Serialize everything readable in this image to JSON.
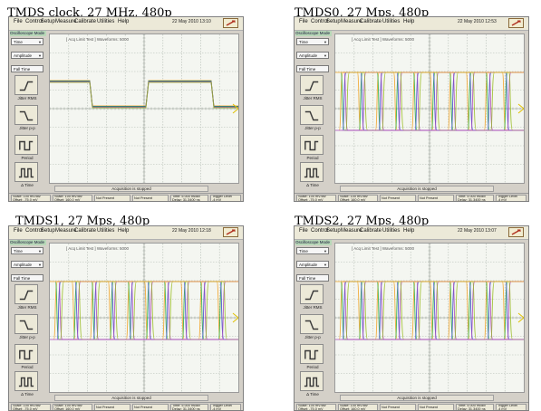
{
  "panels": [
    {
      "caption": "TMDS clock, 27 MHz, 480p",
      "date": "22 May 2010  13:10",
      "acq_title": "[ Acq Limit Test ]   Waveforms: 5000",
      "signal": "clock"
    },
    {
      "caption": "TMDS0, 27 Mps, 480p",
      "date": "22 May 2010  12:53",
      "acq_title": "[ Acq Limit Test ]   Waveforms: 5000",
      "signal": "eye"
    },
    {
      "caption": "TMDS1, 27 Mps, 480p",
      "date": "22 May 2010  12:18",
      "acq_title": "[ Acq Limit Test ]   Waveforms: 5000",
      "signal": "eye"
    },
    {
      "caption": "TMDS2, 27 Mps, 480p",
      "date": "22 May 2010  13:07",
      "acq_title": "[ Acq Limit Test ]   Waveforms: 5000",
      "signal": "eye"
    }
  ],
  "menu": [
    "File",
    "Control",
    "Setup",
    "Measure",
    "Calibrate",
    "Utilities",
    "Help"
  ],
  "mode_label": "Oscilloscope Mode",
  "sidebar": {
    "select_time": "Time",
    "select_amplitude": "Amplitude",
    "select_falltime": "Fall Time",
    "btn_jitter_rms": "Jitter RMS",
    "btn_jitter_pp": "Jitter p-p",
    "btn_period": "Period",
    "btn_more": "Δ Time"
  },
  "acq_status": "Acquisition is stopped",
  "bottom": {
    "ch1_scale": "Scale: 100 mV/div",
    "ch1_offset": "Offset: -75.0 mV",
    "ch2_scale": "Scale: 100 mV/div",
    "ch2_offset": "Offset: 160.0 mV",
    "ch3": "Not Present",
    "ch4": "Not Present",
    "time_scale": "Time: 5.000 ns/div",
    "time_delay": "Delay: 31.3400 ns",
    "trig_label": "Trigger Level",
    "trig_value": "-4 mV"
  },
  "colors": {
    "trace_orange": "#f0a020",
    "trace_green": "#22aa33",
    "trace_blue": "#3344cc",
    "trace_purple": "#aa44bb",
    "trace_yellow_green": "#99bb22",
    "grid": "#b4bcb4",
    "marker": "#e0c000"
  },
  "icons": {
    "close": "close-icon",
    "rising_edge": "rising-edge-icon",
    "falling_edge": "falling-edge-icon",
    "period": "period-icon",
    "pulse": "pulse-icon"
  }
}
